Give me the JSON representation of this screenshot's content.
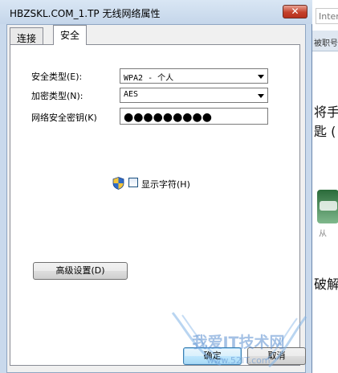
{
  "window": {
    "title": "HBZSKL.COM_1.TP 无线网络属性",
    "close_label": "✕"
  },
  "tabs": [
    {
      "label": "连接"
    },
    {
      "label": "安全"
    }
  ],
  "form": {
    "security_type": {
      "label": "安全类型(E):",
      "value": "WPA2 - 个人"
    },
    "encryption_type": {
      "label": "加密类型(N):",
      "value": "AES"
    },
    "key": {
      "label": "网络安全密钥(K)",
      "value": "●●●●●●●●●"
    },
    "show_chars": {
      "label": "显示字符(H)",
      "checked": false
    }
  },
  "buttons": {
    "advanced": "高级设置(D)",
    "ok": "确定",
    "cancel": "取消"
  },
  "background_page": {
    "search_text": "Inter",
    "nav_text": "被职号",
    "line1": "将手",
    "line2": "匙 (",
    "line3": "破解",
    "small": "从"
  },
  "watermark": {
    "text": "我爱IT技术网",
    "url": "www.52IT.com"
  },
  "colors": {
    "title_bar": "#c5d6ea",
    "close": "#c4412b",
    "ok_button": "#bee6fd"
  },
  "icons": {
    "shield": "uac-shield-icon",
    "dropdown": "chevron-down-icon"
  }
}
